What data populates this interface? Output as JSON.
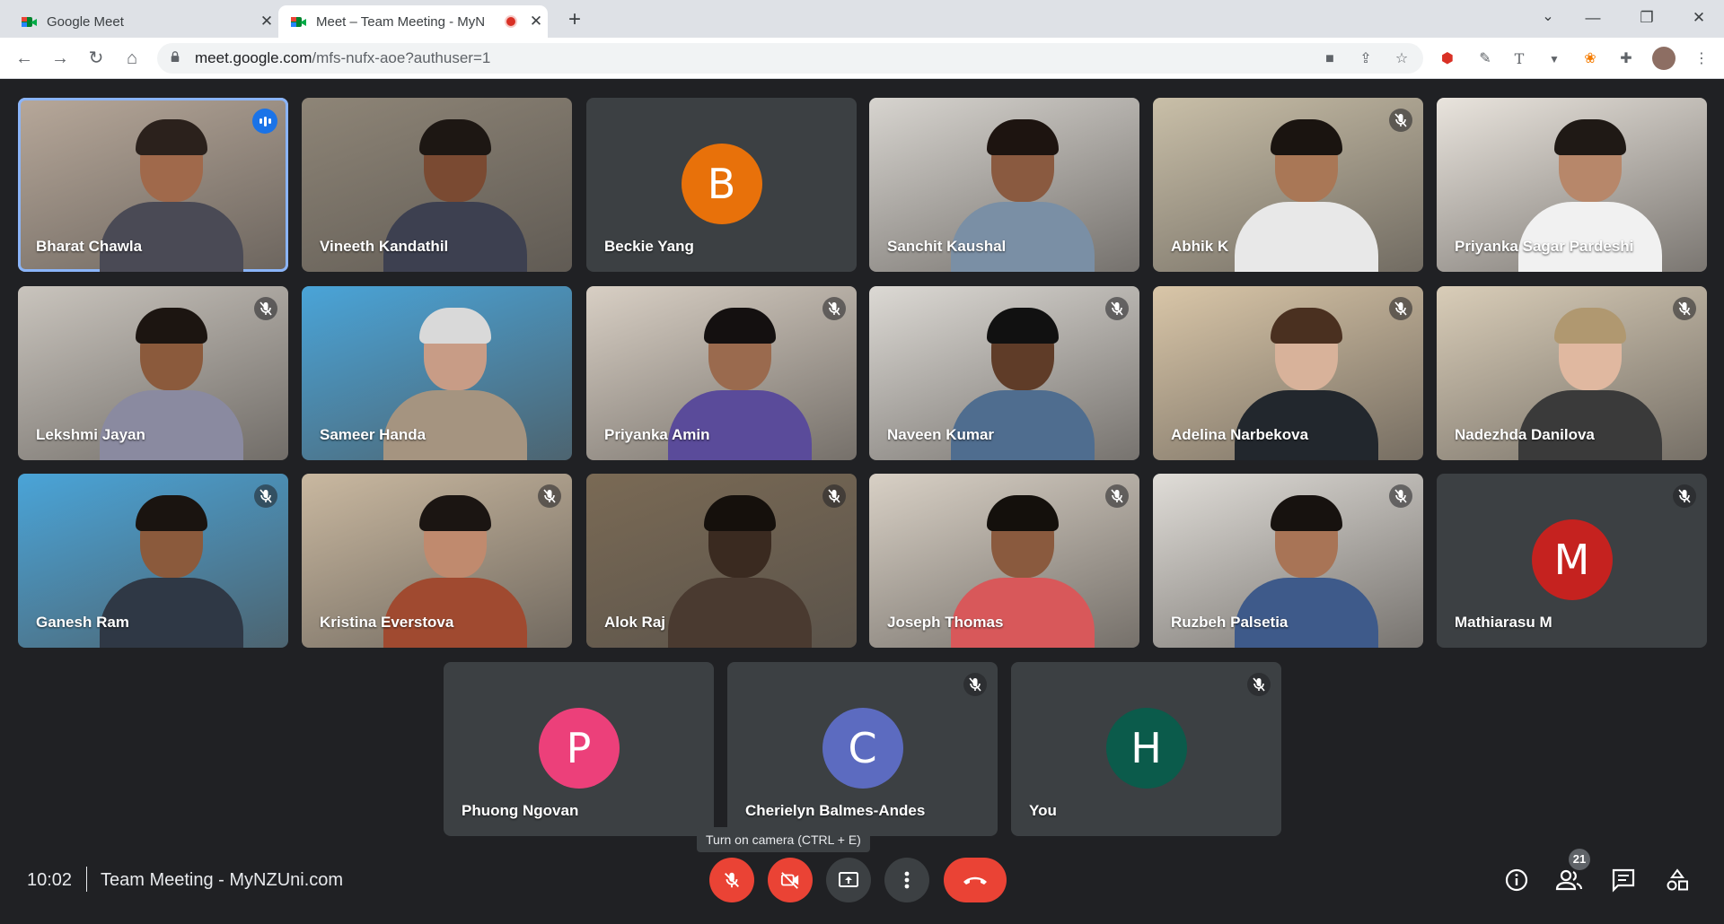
{
  "browser": {
    "tabs": [
      {
        "title": "Google Meet",
        "active": false
      },
      {
        "title": "Meet – Team Meeting - MyN",
        "active": true,
        "recording": true
      }
    ],
    "url_host": "meet.google.com",
    "url_path": "/mfs-nufx-aoe?authuser=1",
    "window_controls": [
      "chevron-down-icon",
      "minimize-icon",
      "restore-icon",
      "close-icon"
    ]
  },
  "participants": [
    {
      "name": "Bharat Chawla",
      "type": "video",
      "muted": false,
      "speaking": true
    },
    {
      "name": "Vineeth Kandathil",
      "type": "video",
      "muted": false
    },
    {
      "name": "Beckie Yang",
      "type": "avatar",
      "initial": "B",
      "color": "#e8710a",
      "muted": false
    },
    {
      "name": "Sanchit Kaushal",
      "type": "video",
      "muted": false
    },
    {
      "name": "Abhik K",
      "type": "video",
      "muted": true
    },
    {
      "name": "Priyanka Sagar Pardeshi",
      "type": "video",
      "muted": false
    },
    {
      "name": "Lekshmi Jayan",
      "type": "video",
      "muted": true
    },
    {
      "name": "Sameer Handa",
      "type": "video",
      "muted": false
    },
    {
      "name": "Priyanka Amin",
      "type": "video",
      "muted": true
    },
    {
      "name": "Naveen Kumar",
      "type": "video",
      "muted": true
    },
    {
      "name": "Adelina Narbekova",
      "type": "video",
      "muted": true
    },
    {
      "name": "Nadezhda Danilova",
      "type": "video",
      "muted": true
    },
    {
      "name": "Ganesh Ram",
      "type": "video",
      "muted": true
    },
    {
      "name": "Kristina Everstova",
      "type": "video",
      "muted": true
    },
    {
      "name": "Alok Raj",
      "type": "video",
      "muted": true
    },
    {
      "name": "Joseph Thomas",
      "type": "video",
      "muted": true
    },
    {
      "name": "Ruzbeh Palsetia",
      "type": "video",
      "muted": true
    },
    {
      "name": "Mathiarasu M",
      "type": "avatar",
      "initial": "M",
      "color": "#c5221f",
      "muted": true
    },
    {
      "name": "Phuong Ngovan",
      "type": "avatar",
      "initial": "P",
      "color": "#ec407a",
      "muted": false
    },
    {
      "name": "Cherielyn Balmes-Andes",
      "type": "avatar",
      "initial": "C",
      "color": "#5c6bc0",
      "muted": true
    },
    {
      "name": "You",
      "type": "avatar",
      "initial": "H",
      "color": "#0b5b4b",
      "muted": true
    }
  ],
  "bottom_bar": {
    "time": "10:02",
    "meeting_title": "Team Meeting - MyNZUni.com",
    "camera_tooltip": "Turn on camera (CTRL + E)",
    "people_count": "21"
  }
}
